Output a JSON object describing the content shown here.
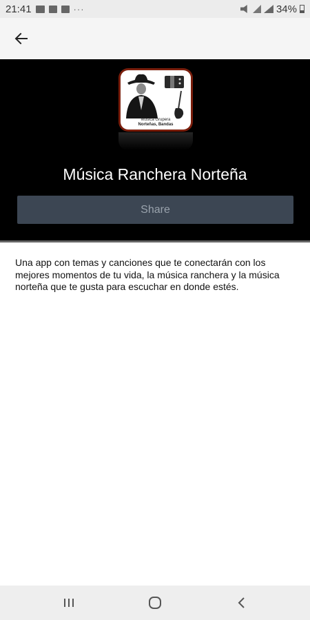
{
  "status_bar": {
    "time": "21:41",
    "dots": "···",
    "battery_percent": "34%"
  },
  "app_bar": {
    "back_icon": "arrow-left-icon"
  },
  "hero": {
    "app_icon_caption_line1": "Música Grupera",
    "app_icon_caption_line2": "Norteñas, Bandas",
    "title": "Música Ranchera Norteña",
    "share_label": "Share"
  },
  "description": "Una app con temas y canciones que te conectarán con los mejores momentos de tu vida, la música ranchera y la música norteña que te gusta para escuchar en donde estés.",
  "nav_bar": {
    "recents_icon": "recent-apps-icon",
    "home_icon": "home-icon",
    "back_icon": "back-chevron-icon"
  },
  "colors": {
    "hero_background": "#000000",
    "share_button": "#3c4653",
    "icon_border": "#7a1e0c"
  }
}
